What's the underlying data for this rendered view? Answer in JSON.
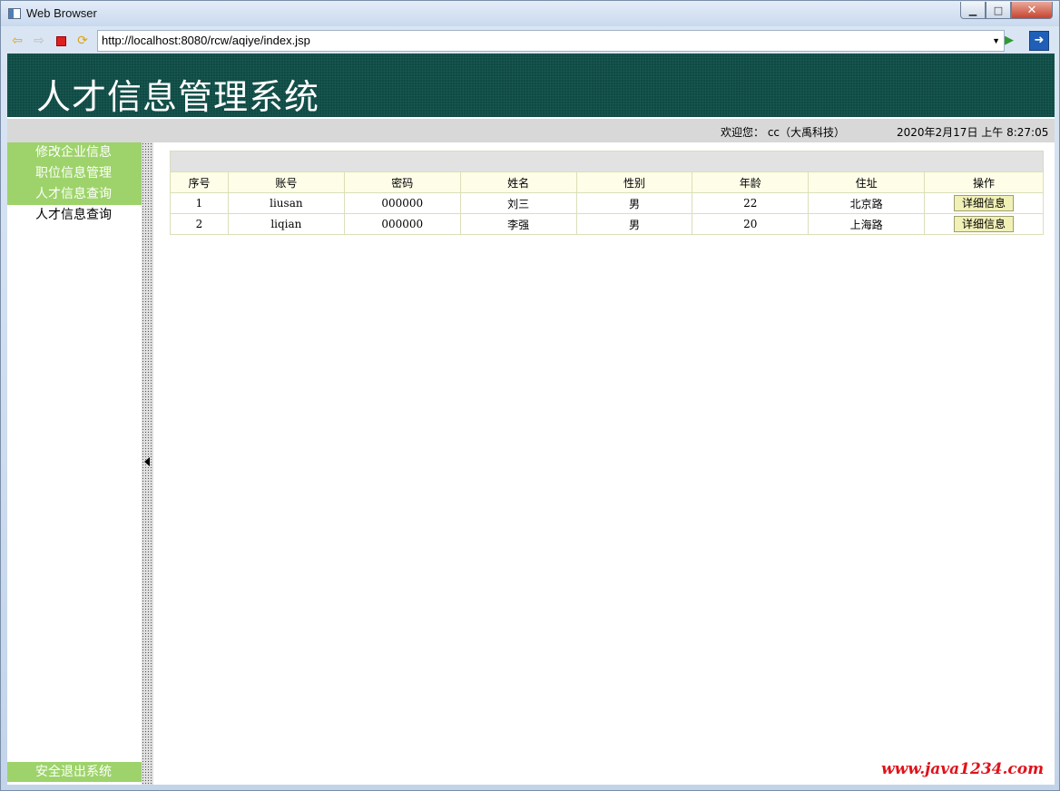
{
  "window": {
    "title": "Web Browser"
  },
  "browser": {
    "url": "http://localhost:8080/rcw/aqiye/index.jsp"
  },
  "header": {
    "title": "人才信息管理系统"
  },
  "infobar": {
    "welcome": "欢迎您：  cc（大禹科技）",
    "datetime": "2020年2月17日 上午 8:27:05"
  },
  "sidebar": {
    "items": [
      {
        "label": "修改企业信息"
      },
      {
        "label": "职位信息管理"
      },
      {
        "label": "人才信息查询"
      },
      {
        "label": "人才信息查询"
      }
    ],
    "exit_label": "安全退出系统"
  },
  "table": {
    "headers": [
      "序号",
      "账号",
      "密码",
      "姓名",
      "性别",
      "年龄",
      "住址",
      "操作"
    ],
    "rows": [
      {
        "no": "1",
        "account": "liusan",
        "password": "000000",
        "name": "刘三",
        "gender": "男",
        "age": "22",
        "address": "北京路",
        "action": "详细信息"
      },
      {
        "no": "2",
        "account": "liqian",
        "password": "000000",
        "name": "李强",
        "gender": "男",
        "age": "20",
        "address": "上海路",
        "action": "详细信息"
      }
    ]
  },
  "watermark": "www.java1234.com",
  "colors": {
    "header_bg": "#0f4a44",
    "menu_green": "#9dd36a",
    "watermark": "#e0121b"
  }
}
